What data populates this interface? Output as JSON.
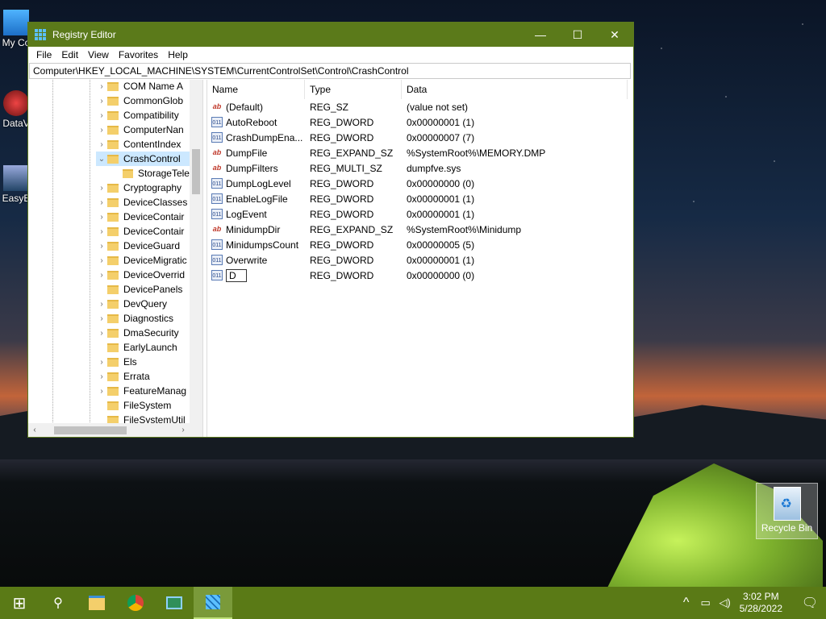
{
  "desktop": {
    "icons": [
      {
        "label": "My Co"
      },
      {
        "label": "DataV"
      },
      {
        "label": "EasyE"
      }
    ],
    "recycle_bin": "Recycle Bin"
  },
  "window": {
    "title": "Registry Editor",
    "controls": {
      "minimize": "—",
      "maximize": "☐",
      "close": "✕"
    },
    "menu": [
      "File",
      "Edit",
      "View",
      "Favorites",
      "Help"
    ],
    "address": "Computer\\HKEY_LOCAL_MACHINE\\SYSTEM\\CurrentControlSet\\Control\\CrashControl"
  },
  "tree": {
    "items": [
      {
        "label": "COM Name A",
        "chevron": "›"
      },
      {
        "label": "CommonGlob",
        "chevron": "›"
      },
      {
        "label": "Compatibility",
        "chevron": "›"
      },
      {
        "label": "ComputerNan",
        "chevron": "›"
      },
      {
        "label": "ContentIndex",
        "chevron": "›"
      },
      {
        "label": "CrashControl",
        "chevron": "⌄",
        "selected": true
      },
      {
        "label": "StorageTele",
        "chevron": "",
        "child": true
      },
      {
        "label": "Cryptography",
        "chevron": "›"
      },
      {
        "label": "DeviceClasses",
        "chevron": "›"
      },
      {
        "label": "DeviceContair",
        "chevron": "›"
      },
      {
        "label": "DeviceContair",
        "chevron": "›"
      },
      {
        "label": "DeviceGuard",
        "chevron": "›"
      },
      {
        "label": "DeviceMigratic",
        "chevron": "›"
      },
      {
        "label": "DeviceOverrid",
        "chevron": "›"
      },
      {
        "label": "DevicePanels",
        "chevron": ""
      },
      {
        "label": "DevQuery",
        "chevron": "›"
      },
      {
        "label": "Diagnostics",
        "chevron": "›"
      },
      {
        "label": "DmaSecurity",
        "chevron": "›"
      },
      {
        "label": "EarlyLaunch",
        "chevron": ""
      },
      {
        "label": "Els",
        "chevron": "›"
      },
      {
        "label": "Errata",
        "chevron": "›"
      },
      {
        "label": "FeatureManag",
        "chevron": "›"
      },
      {
        "label": "FileSystem",
        "chevron": ""
      },
      {
        "label": "FileSystemUtil",
        "chevron": ""
      }
    ],
    "scroll_left": "‹",
    "scroll_right": "›"
  },
  "list": {
    "headers": {
      "name": "Name",
      "type": "Type",
      "data": "Data"
    },
    "rows": [
      {
        "icon": "ab",
        "kind": "sz",
        "name": "(Default)",
        "type": "REG_SZ",
        "data": "(value not set)"
      },
      {
        "icon": "011",
        "kind": "bin",
        "name": "AutoReboot",
        "type": "REG_DWORD",
        "data": "0x00000001 (1)"
      },
      {
        "icon": "011",
        "kind": "bin",
        "name": "CrashDumpEna...",
        "type": "REG_DWORD",
        "data": "0x00000007 (7)"
      },
      {
        "icon": "ab",
        "kind": "sz",
        "name": "DumpFile",
        "type": "REG_EXPAND_SZ",
        "data": "%SystemRoot%\\MEMORY.DMP"
      },
      {
        "icon": "ab",
        "kind": "sz",
        "name": "DumpFilters",
        "type": "REG_MULTI_SZ",
        "data": "dumpfve.sys"
      },
      {
        "icon": "011",
        "kind": "bin",
        "name": "DumpLogLevel",
        "type": "REG_DWORD",
        "data": "0x00000000 (0)"
      },
      {
        "icon": "011",
        "kind": "bin",
        "name": "EnableLogFile",
        "type": "REG_DWORD",
        "data": "0x00000001 (1)"
      },
      {
        "icon": "011",
        "kind": "bin",
        "name": "LogEvent",
        "type": "REG_DWORD",
        "data": "0x00000001 (1)"
      },
      {
        "icon": "ab",
        "kind": "sz",
        "name": "MinidumpDir",
        "type": "REG_EXPAND_SZ",
        "data": "%SystemRoot%\\Minidump"
      },
      {
        "icon": "011",
        "kind": "bin",
        "name": "MinidumpsCount",
        "type": "REG_DWORD",
        "data": "0x00000005 (5)"
      },
      {
        "icon": "011",
        "kind": "bin",
        "name": "Overwrite",
        "type": "REG_DWORD",
        "data": "0x00000001 (1)"
      }
    ],
    "editing_row": {
      "icon": "011",
      "value": "D",
      "type": "REG_DWORD",
      "data": "0x00000000 (0)"
    }
  },
  "taskbar": {
    "start": "⊞",
    "search": "⚲",
    "tray_chevron": "^",
    "time": "3:02 PM",
    "date": "5/28/2022"
  }
}
